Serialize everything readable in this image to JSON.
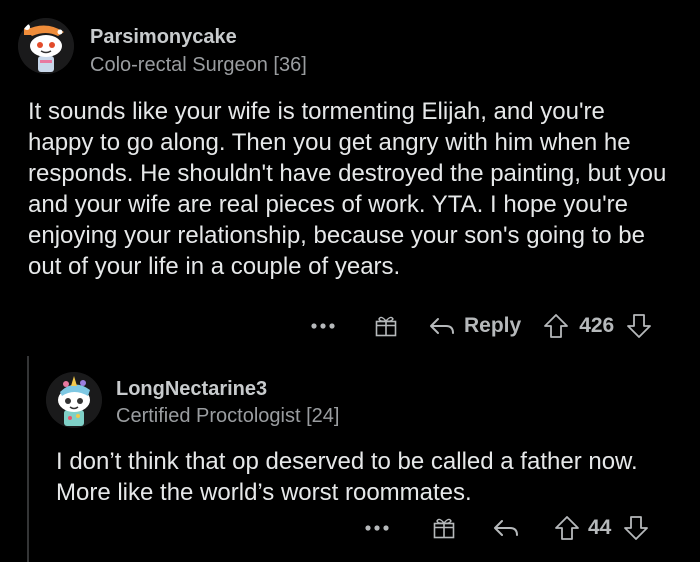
{
  "comment1": {
    "username": "Parsimonycake",
    "flair": "Colo-rectal Surgeon [36]",
    "body": "It sounds like your wife is tormenting Elijah, and you're happy to go along.  Then you get angry with him when he responds.  He shouldn't have destroyed the painting, but you and your wife are real pieces of work.  YTA. I hope you're enjoying your relationship, because your son's going to be out of your life in a couple of years.",
    "reply_label": "Reply",
    "score": "426"
  },
  "comment2": {
    "username": "LongNectarine3",
    "flair": "Certified Proctologist [24]",
    "body": "I don’t think that op deserved to be called a father now. More like the world’s worst roommates.",
    "score": "44"
  },
  "icons": [
    "more-icon",
    "award-icon",
    "reply-icon",
    "upvote-icon",
    "downvote-icon"
  ],
  "colors": {
    "background": "#000000",
    "text": "#e6e8e9",
    "muted": "#9a9da0"
  }
}
